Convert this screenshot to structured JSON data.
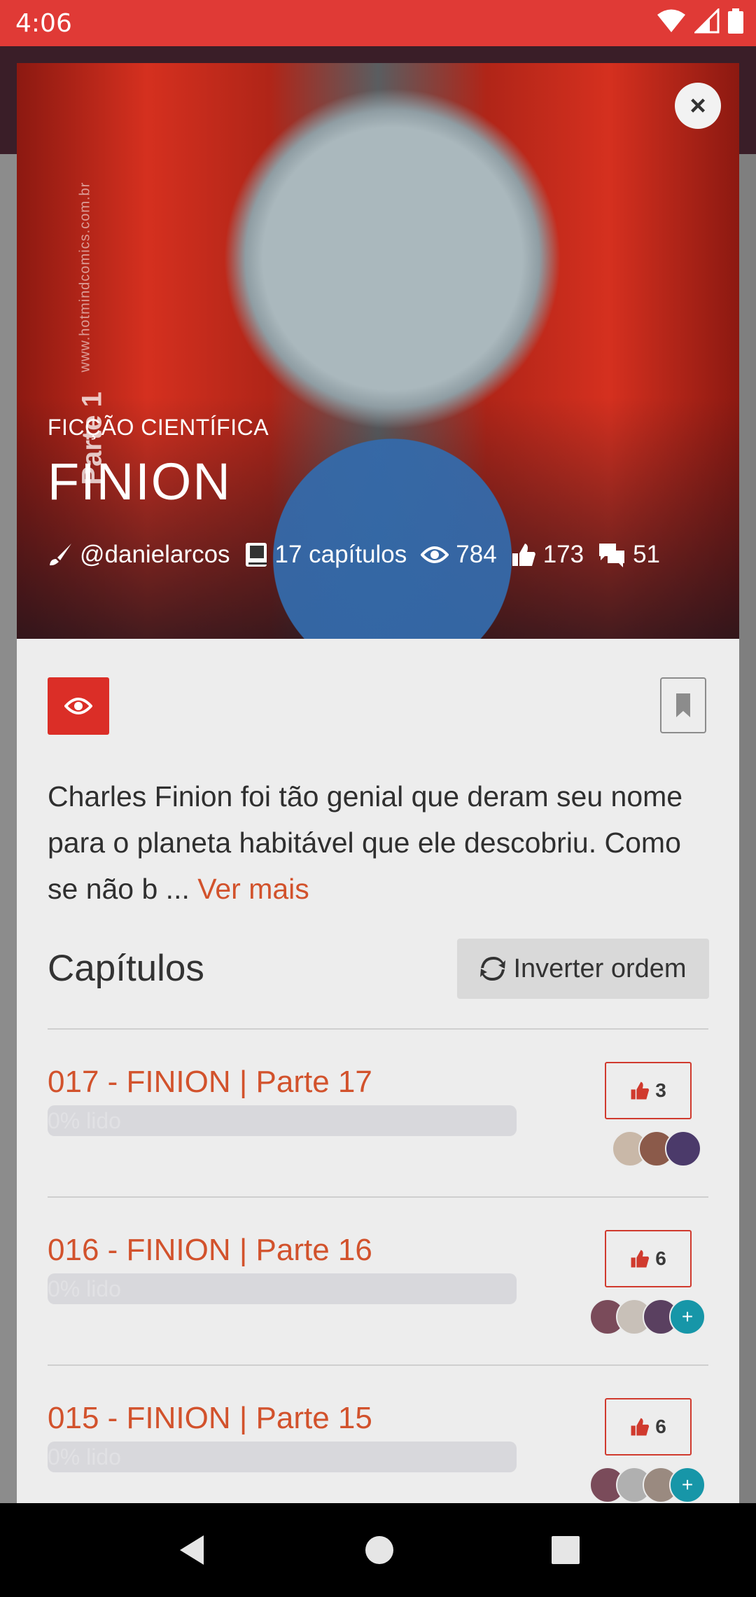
{
  "status_bar": {
    "time": "4:06"
  },
  "cover": {
    "watermark_site": "www.hotmindcomics.com.br",
    "watermark_part": "Parte 1",
    "genre": "FICÇÃO CIENTÍFICA",
    "title": "FINION",
    "author": "@danielarcos",
    "chapters": "17 capítulos",
    "views": "784",
    "likes": "173",
    "comments": "51"
  },
  "description": {
    "text": "Charles Finion foi tão genial que deram seu nome para o planeta habitável que ele descobriu. Como se não b ...",
    "more_label": "Ver mais"
  },
  "chapters_section": {
    "title": "Capítulos",
    "invert_label": "Inverter ordem"
  },
  "chapters": [
    {
      "title": "017 - FINION | Parte 17",
      "progress": "0% lido",
      "progress_value": 0,
      "likes": "3",
      "avatars": [
        "#c9b8a8",
        "#8b5a4a",
        "#4b3a6a"
      ],
      "has_more": false
    },
    {
      "title": "016 - FINION | Parte 16",
      "progress": "0% lido",
      "progress_value": 0,
      "likes": "6",
      "avatars": [
        "#7a4b5a",
        "#c8c0b8",
        "#5a4060"
      ],
      "has_more": true,
      "more_label": "+"
    },
    {
      "title": "015 - FINION | Parte 15",
      "progress": "0% lido",
      "progress_value": 0,
      "likes": "6",
      "avatars": [
        "#7a4b5a",
        "#b0b0b0",
        "#9a8a80"
      ],
      "has_more": true,
      "more_label": "+"
    }
  ],
  "colors": {
    "status_bar": "#e03a36",
    "accent": "#d2522c",
    "button_red": "#db2e27",
    "teal": "#1796a8"
  },
  "icons": {
    "author": "brush-icon",
    "chapters": "book-icon",
    "views": "eye-icon",
    "likes": "thumbs-up-icon",
    "comments": "comments-icon",
    "close": "close-icon",
    "view": "eye-icon",
    "bookmark": "bookmark-icon",
    "invert": "refresh-icon"
  }
}
